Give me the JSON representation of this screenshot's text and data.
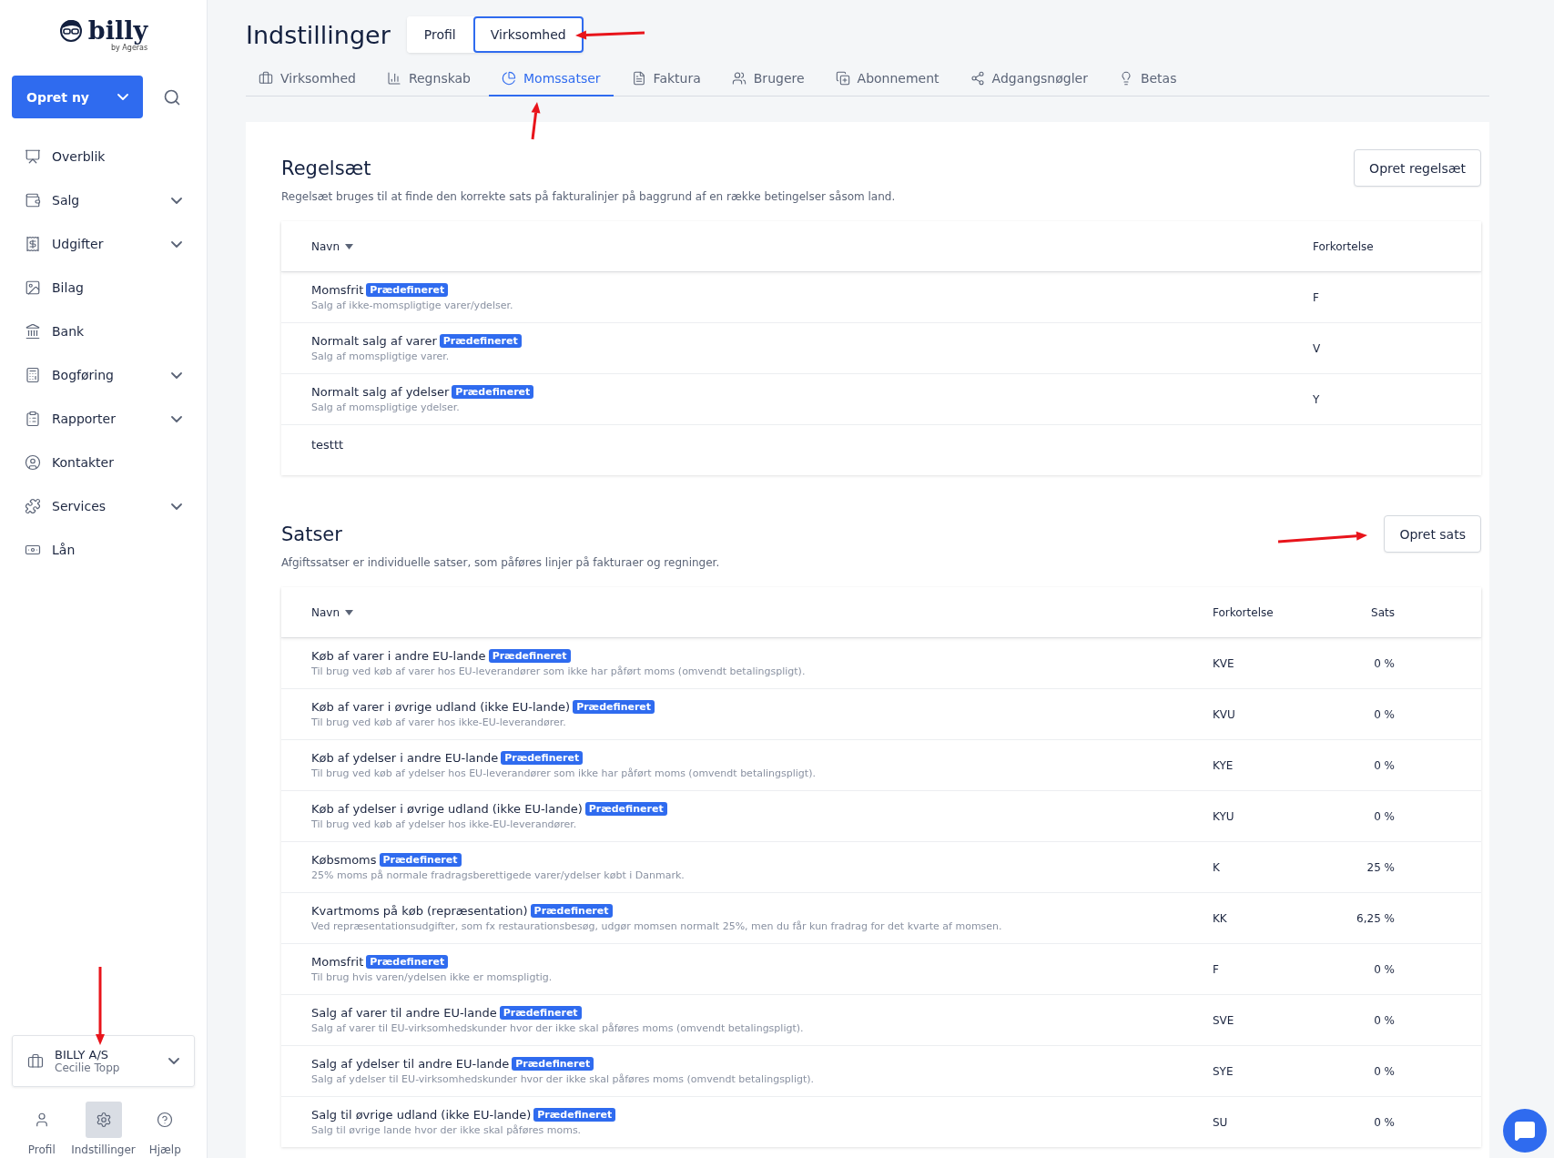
{
  "sidebar": {
    "logo": {
      "name": "billy",
      "tagline": "by Ageras"
    },
    "create_button": "Opret ny",
    "items": [
      {
        "label": "Overblik",
        "expandable": false
      },
      {
        "label": "Salg",
        "expandable": true
      },
      {
        "label": "Udgifter",
        "expandable": true
      },
      {
        "label": "Bilag",
        "expandable": false
      },
      {
        "label": "Bank",
        "expandable": false
      },
      {
        "label": "Bogføring",
        "expandable": true
      },
      {
        "label": "Rapporter",
        "expandable": true
      },
      {
        "label": "Kontakter",
        "expandable": false
      },
      {
        "label": "Services",
        "expandable": true
      },
      {
        "label": "Lån",
        "expandable": false
      }
    ],
    "company": {
      "name": "BILLY A/S",
      "user": "Cecilie Topp"
    },
    "bottom_nav": [
      {
        "label": "Profil",
        "selected": false
      },
      {
        "label": "Indstillinger",
        "selected": true
      },
      {
        "label": "Hjælp",
        "selected": false
      }
    ]
  },
  "header": {
    "title": "Indstillinger",
    "segments": [
      {
        "label": "Profil",
        "selected": false
      },
      {
        "label": "Virksomhed",
        "selected": true
      }
    ]
  },
  "tabs": [
    {
      "label": "Virksomhed",
      "selected": false
    },
    {
      "label": "Regnskab",
      "selected": false
    },
    {
      "label": "Momssatser",
      "selected": true
    },
    {
      "label": "Faktura",
      "selected": false
    },
    {
      "label": "Brugere",
      "selected": false
    },
    {
      "label": "Abonnement",
      "selected": false
    },
    {
      "label": "Adgangsnøgler",
      "selected": false
    },
    {
      "label": "Betas",
      "selected": false
    }
  ],
  "rulesets": {
    "title": "Regelsæt",
    "description": "Regelsæt bruges til at finde den korrekte sats på fakturalinjer på baggrund af en række betingelser såsom land.",
    "button": "Opret regelsæt",
    "columns": [
      "Navn",
      "Forkortelse"
    ],
    "rows": [
      {
        "name": "Momsfrit",
        "badge": "Prædefineret",
        "description": "Salg af ikke-momspligtige varer/ydelser.",
        "abbreviation": "F"
      },
      {
        "name": "Normalt salg af varer",
        "badge": "Prædefineret",
        "description": "Salg af momspligtige varer.",
        "abbreviation": "V"
      },
      {
        "name": "Normalt salg af ydelser",
        "badge": "Prædefineret",
        "description": "Salg af momspligtige ydelser.",
        "abbreviation": "Y"
      },
      {
        "name": "testtt"
      }
    ]
  },
  "rates": {
    "title": "Satser",
    "description": "Afgiftssatser er individuelle satser, som påføres linjer på fakturaer og regninger.",
    "button": "Opret sats",
    "columns": [
      "Navn",
      "Forkortelse",
      "Sats"
    ],
    "rows": [
      {
        "name": "Køb af varer i andre EU-lande",
        "badge": "Prædefineret",
        "description": "Til brug ved køb af varer hos EU-leverandører som ikke har påført moms (omvendt betalingspligt).",
        "abbreviation": "KVE",
        "rate": "0 %"
      },
      {
        "name": "Køb af varer i øvrige udland (ikke EU-lande)",
        "badge": "Prædefineret",
        "description": "Til brug ved køb af varer hos ikke-EU-leverandører.",
        "abbreviation": "KVU",
        "rate": "0 %"
      },
      {
        "name": "Køb af ydelser i andre EU-lande",
        "badge": "Prædefineret",
        "description": "Til brug ved køb af ydelser hos EU-leverandører som ikke har påført moms (omvendt betalingspligt).",
        "abbreviation": "KYE",
        "rate": "0 %"
      },
      {
        "name": "Køb af ydelser i øvrige udland (ikke EU-lande)",
        "badge": "Prædefineret",
        "description": "Til brug ved køb af ydelser hos ikke-EU-leverandører.",
        "abbreviation": "KYU",
        "rate": "0 %"
      },
      {
        "name": "Købsmoms",
        "badge": "Prædefineret",
        "description": "25% moms på normale fradragsberettigede varer/ydelser købt i Danmark.",
        "abbreviation": "K",
        "rate": "25 %"
      },
      {
        "name": "Kvartmoms på køb (repræsentation)",
        "badge": "Prædefineret",
        "description": "Ved repræsentationsudgifter, som fx restaurationsbesøg, udgør momsen normalt 25%, men du får kun fradrag for det kvarte af momsen.",
        "abbreviation": "KK",
        "rate": "6,25 %"
      },
      {
        "name": "Momsfrit",
        "badge": "Prædefineret",
        "description": "Til brug hvis varen/ydelsen ikke er momspligtig.",
        "abbreviation": "F",
        "rate": "0 %"
      },
      {
        "name": "Salg af varer til andre EU-lande",
        "badge": "Prædefineret",
        "description": "Salg af varer til EU-virksomhedskunder hvor der ikke skal påføres moms (omvendt betalingspligt).",
        "abbreviation": "SVE",
        "rate": "0 %"
      },
      {
        "name": "Salg af ydelser til andre EU-lande",
        "badge": "Prædefineret",
        "description": "Salg af ydelser til EU-virksomhedskunder hvor der ikke skal påføres moms (omvendt betalingspligt).",
        "abbreviation": "SYE",
        "rate": "0 %"
      },
      {
        "name": "Salg til øvrige udland (ikke EU-lande)",
        "badge": "Prædefineret",
        "description": "Salg til øvrige lande hvor der ikke skal påføres moms.",
        "abbreviation": "SU",
        "rate": "0 %"
      }
    ]
  }
}
